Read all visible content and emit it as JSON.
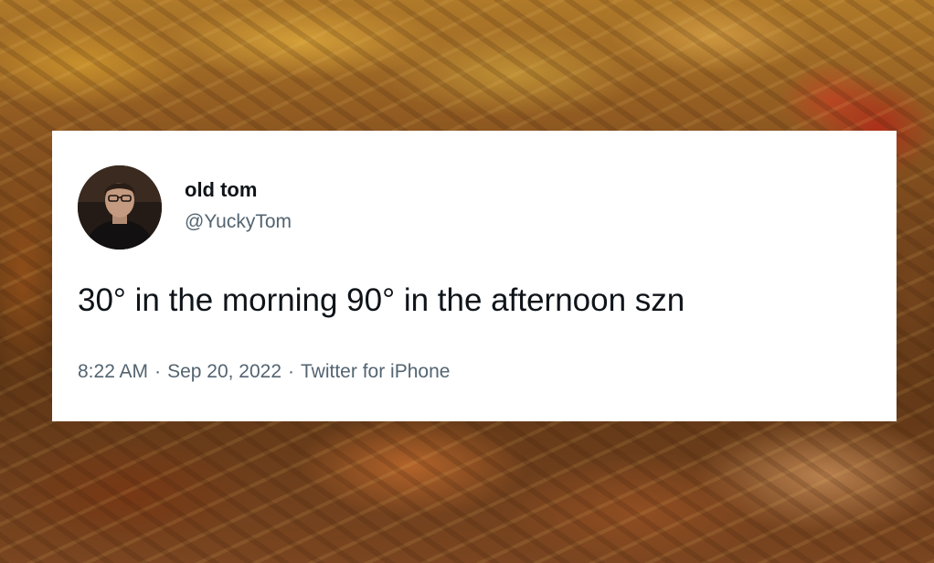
{
  "tweet": {
    "display_name": "old tom",
    "handle": "@YuckyTom",
    "text": "30° in the morning 90° in the afternoon szn",
    "time": "8:22 AM",
    "separator": "·",
    "date": "Sep 20, 2022",
    "source": "Twitter for iPhone"
  },
  "colors": {
    "card_background": "#ffffff",
    "primary_text": "#0f1419",
    "secondary_text": "#536471"
  },
  "icons": {
    "avatar": "profile-photo-avatar"
  }
}
